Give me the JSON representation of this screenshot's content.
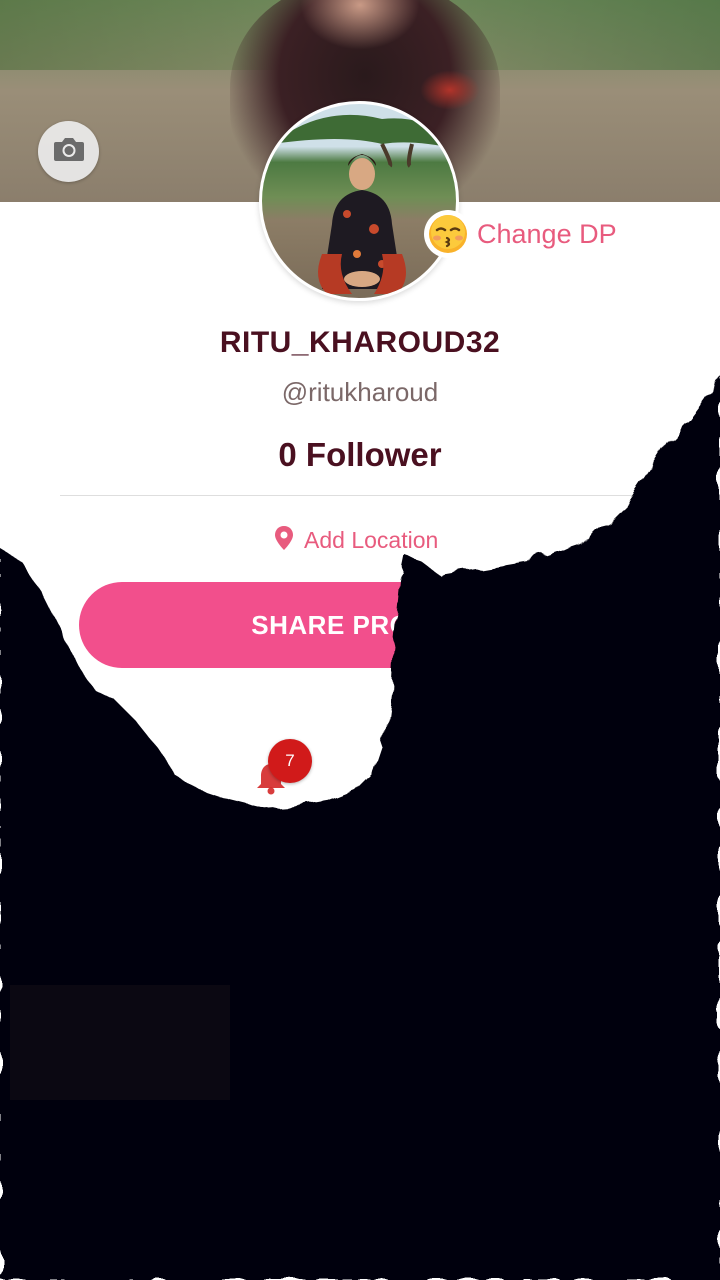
{
  "profile": {
    "change_dp_label": "Change DP",
    "change_dp_emoji": "😚",
    "username": "RITU_KHAROUD32",
    "handle": "@ritukharoud",
    "followers": "0 Follower",
    "location_label": "Add Location",
    "share_label": "SHARE PROFILE"
  },
  "notifications": {
    "badge_count": "7"
  },
  "icons": {
    "camera": "camera-icon",
    "location": "location-pin-icon",
    "bell": "bell-icon"
  },
  "colors": {
    "accent_pink": "#e85b7e",
    "button_pink": "#f24f8c",
    "username_color": "#4a1020",
    "badge_red": "#d11a1a"
  }
}
